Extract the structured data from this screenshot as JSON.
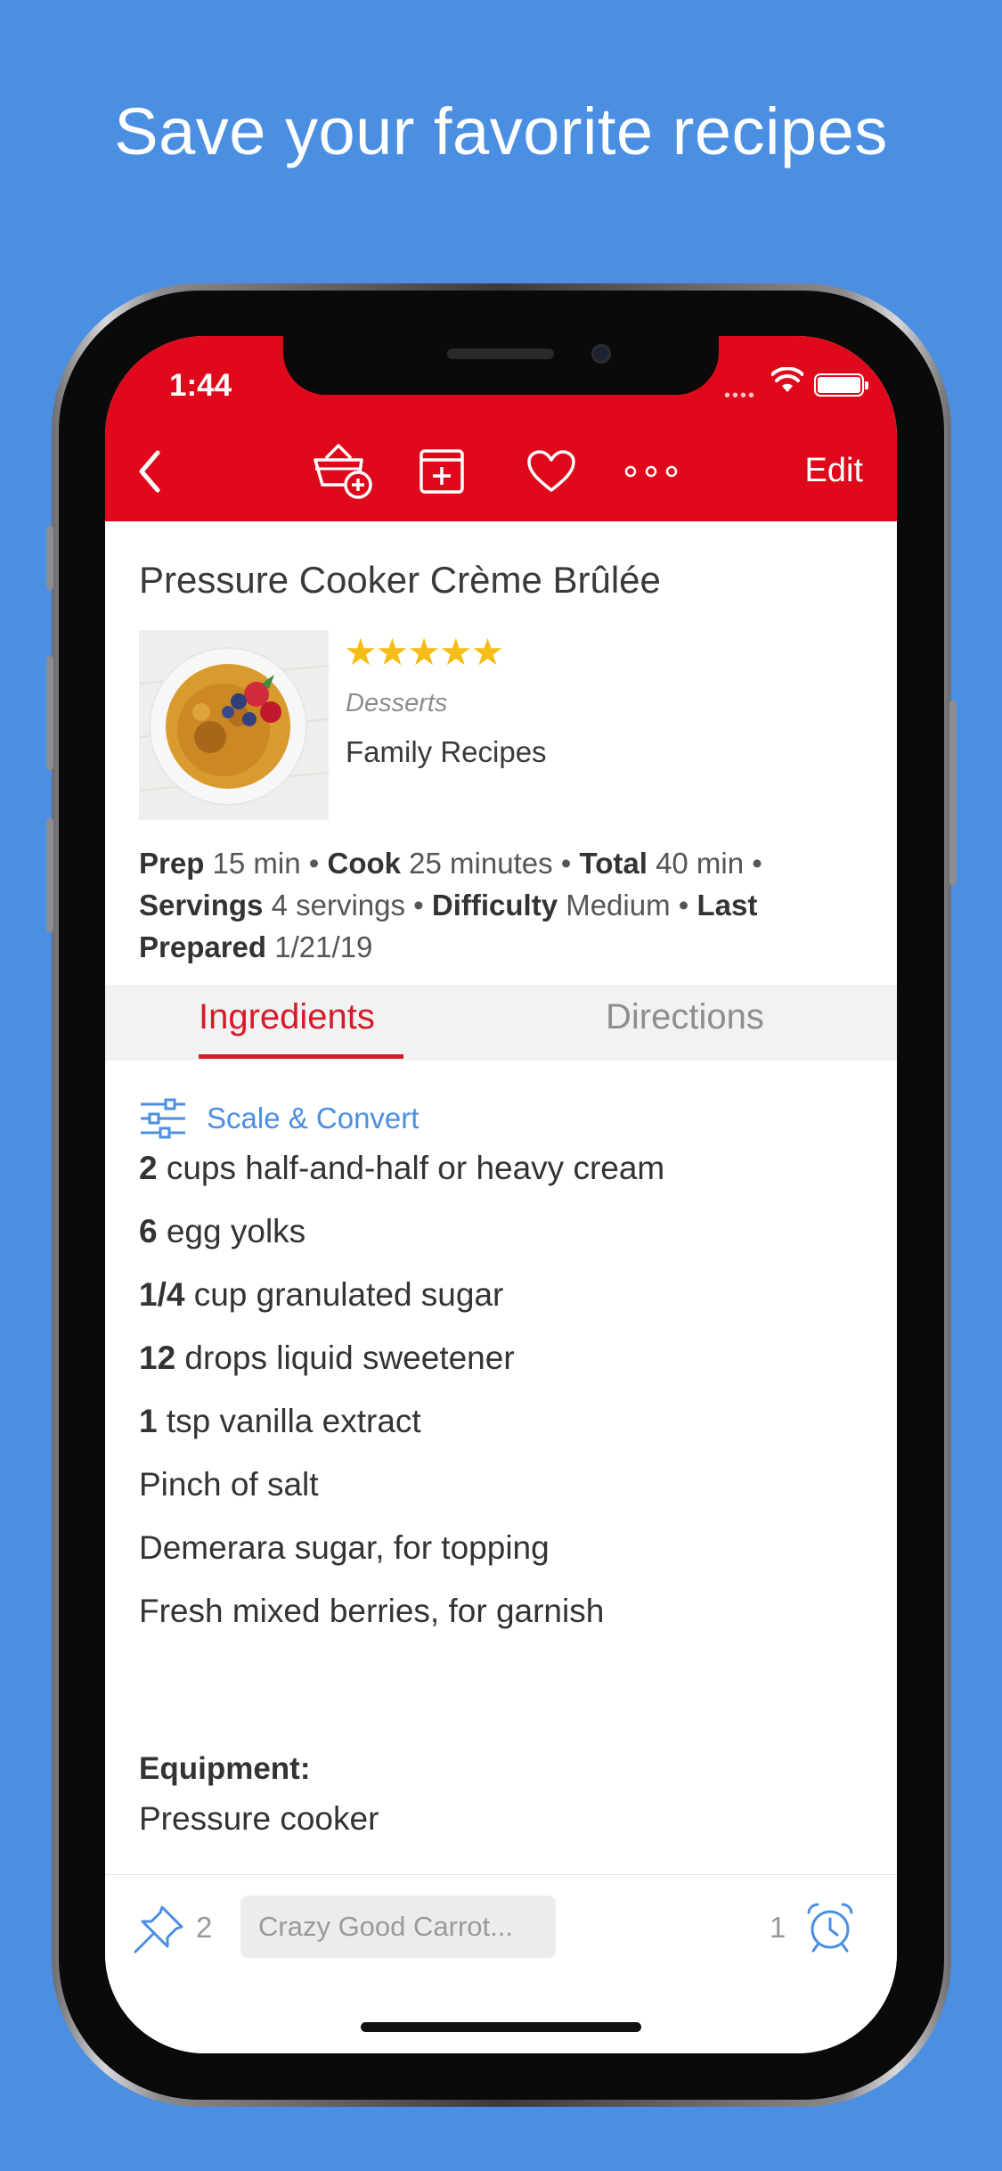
{
  "headline": "Save your favorite recipes",
  "status": {
    "time": "1:44",
    "dots": "••••"
  },
  "nav": {
    "back_icon": "chevron-left-icon",
    "edit_label": "Edit"
  },
  "recipe": {
    "title": "Pressure Cooker Crème Brûlée",
    "rating": 5,
    "stars": "★★★★★",
    "category": "Desserts",
    "collection": "Family Recipes",
    "meta": {
      "prep_label": "Prep",
      "prep_value": "15 min",
      "cook_label": "Cook",
      "cook_value": "25 minutes",
      "total_label": "Total",
      "total_value": "40 min",
      "servings_label": "Servings",
      "servings_value": "4 servings",
      "difficulty_label": "Difficulty",
      "difficulty_value": "Medium",
      "last_label": "Last Prepared",
      "last_value": "1/21/19"
    }
  },
  "tabs": {
    "ingredients": "Ingredients",
    "directions": "Directions"
  },
  "scale_label": "Scale & Convert",
  "ingredients": [
    {
      "qty": "2",
      "text": " cups half-and-half or heavy cream"
    },
    {
      "qty": "6",
      "text": " egg yolks"
    },
    {
      "qty": "1/4",
      "text": " cup granulated sugar"
    },
    {
      "qty": "12",
      "text": " drops liquid sweetener"
    },
    {
      "qty": "1",
      "text": " tsp vanilla extract"
    },
    {
      "qty": "",
      "text": "Pinch of salt"
    },
    {
      "qty": "",
      "text": "Demerara sugar, for topping"
    },
    {
      "qty": "",
      "text": "Fresh mixed berries, for garnish"
    }
  ],
  "equipment": {
    "heading": "Equipment:",
    "value": "Pressure cooker"
  },
  "bottom": {
    "pin_count": "2",
    "chip": "Crazy Good Carrot...",
    "timer_count": "1"
  },
  "colors": {
    "background": "#4a8fe2",
    "header": "#e0091c",
    "accent_red": "#d71a2a",
    "link_blue": "#4b8fe2",
    "star": "#f5bd18"
  }
}
